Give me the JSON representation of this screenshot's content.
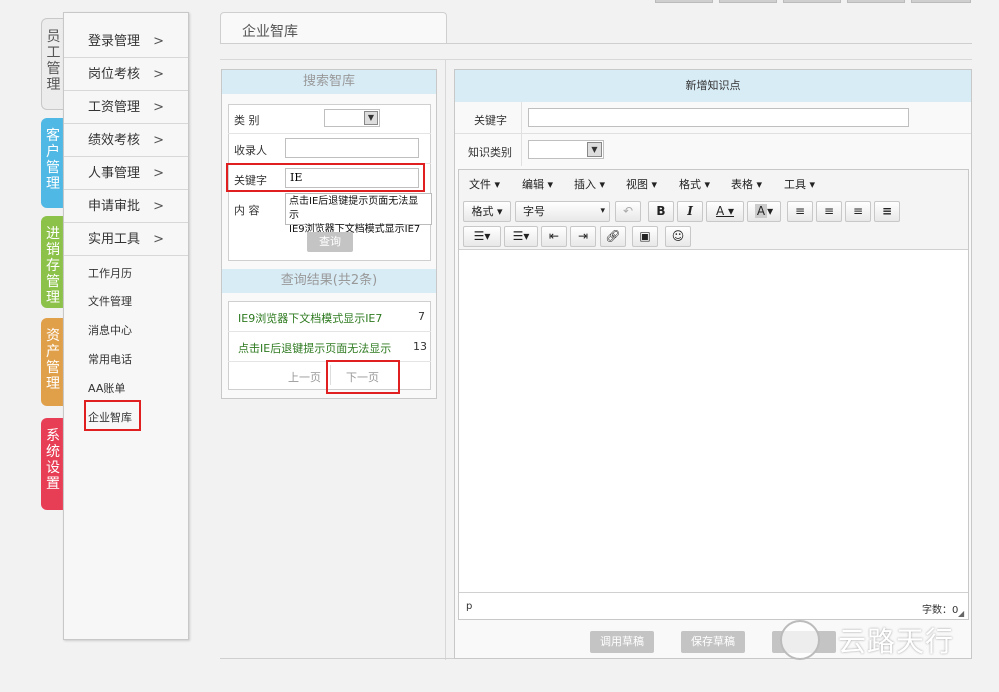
{
  "left_tabs": [
    {
      "label": "员工管理",
      "color": "#ececec",
      "text_color": "#555"
    },
    {
      "label": "客户管理",
      "color": "#4fb8e4",
      "text_color": "#ffffff"
    },
    {
      "label": "进销存管理",
      "color": "#8cc24a",
      "text_color": "#ffffff"
    },
    {
      "label": "资产管理",
      "color": "#e0a04a",
      "text_color": "#ffffff"
    },
    {
      "label": "系统设置",
      "color": "#e83e55",
      "text_color": "#ffffff"
    }
  ],
  "menu": {
    "groups": [
      {
        "label": "登录管理",
        "arrow": ">"
      },
      {
        "label": "岗位考核",
        "arrow": ">"
      },
      {
        "label": "工资管理",
        "arrow": ">"
      },
      {
        "label": "绩效考核",
        "arrow": ">"
      },
      {
        "label": "人事管理",
        "arrow": ">"
      },
      {
        "label": "申请审批",
        "arrow": ">"
      },
      {
        "label": "实用工具",
        "arrow": ">"
      }
    ],
    "subitems": [
      "工作月历",
      "文件管理",
      "消息中心",
      "常用电话",
      "AA账单",
      "企业智库"
    ]
  },
  "page_title": "企业智库",
  "search": {
    "header": "搜索智库",
    "category_label": "类  别",
    "collector_label": "收录人",
    "keyword_label": "关键字",
    "keyword_value": "IE",
    "content_label": "内  容",
    "suggestions": [
      "点击IE后退键提示页面无法显示",
      "IE9浏览器下文档模式显示IE7"
    ],
    "query_button": "查询"
  },
  "results": {
    "header": "查询结果(共2条)",
    "rows": [
      {
        "title": "IE9浏览器下文档模式显示IE7",
        "count": "7"
      },
      {
        "title": "点击IE后退键提示页面无法显示",
        "count": "13"
      }
    ],
    "prev": "上一页",
    "next": "下一页"
  },
  "editor": {
    "header": "新增知识点",
    "keyword_label": "关键字",
    "category_label": "知识类别",
    "menubar": [
      "文件",
      "编辑",
      "插入",
      "视图",
      "格式",
      "表格",
      "工具"
    ],
    "format_label": "格式",
    "fontsize_label": "字号",
    "status_tag": "p",
    "word_count": "字数：0",
    "draft_load": "调用草稿",
    "draft_save": "保存草稿"
  },
  "watermark": "云路天行",
  "colors": {
    "accent_red": "#e02020",
    "header_blue": "#d8ecf6",
    "link_green": "#2d7a1f"
  }
}
